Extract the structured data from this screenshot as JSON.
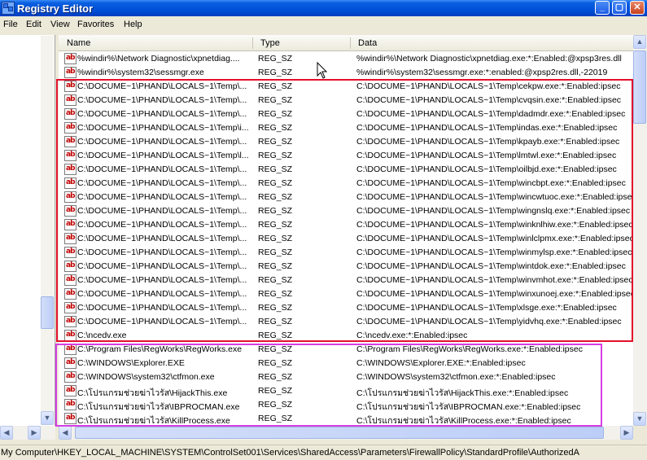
{
  "window": {
    "title": "Registry Editor",
    "min_glyph": "_",
    "max_glyph": "▢",
    "close_glyph": "✕"
  },
  "menu": [
    "File",
    "Edit",
    "View",
    "Favorites",
    "Help"
  ],
  "columns": {
    "name": "Name",
    "type": "Type",
    "data": "Data"
  },
  "icons": {
    "value": "reg-sz-value-icon",
    "value_glyph": "ab",
    "app": "registry-editor-icon",
    "cursor": "mouse-pointer-icon"
  },
  "rows": [
    {
      "name": "%windir%\\Network Diagnostic\\xpnetdiag....",
      "type": "REG_SZ",
      "data": "%windir%\\Network Diagnostic\\xpnetdiag.exe:*:Enabled:@xpsp3res.dll"
    },
    {
      "name": "%windir%\\system32\\sessmgr.exe",
      "type": "REG_SZ",
      "data": "%windir%\\system32\\sessmgr.exe:*:enabled:@xpsp2res.dll,-22019"
    },
    {
      "name": "C:\\DOCUME~1\\PHAND\\LOCALS~1\\Temp\\...",
      "type": "REG_SZ",
      "data": "C:\\DOCUME~1\\PHAND\\LOCALS~1\\Temp\\cekpw.exe:*:Enabled:ipsec"
    },
    {
      "name": "C:\\DOCUME~1\\PHAND\\LOCALS~1\\Temp\\...",
      "type": "REG_SZ",
      "data": "C:\\DOCUME~1\\PHAND\\LOCALS~1\\Temp\\cvqsin.exe:*:Enabled:ipsec"
    },
    {
      "name": "C:\\DOCUME~1\\PHAND\\LOCALS~1\\Temp\\...",
      "type": "REG_SZ",
      "data": "C:\\DOCUME~1\\PHAND\\LOCALS~1\\Temp\\dadmdr.exe:*:Enabled:ipsec"
    },
    {
      "name": "C:\\DOCUME~1\\PHAND\\LOCALS~1\\Temp\\i...",
      "type": "REG_SZ",
      "data": "C:\\DOCUME~1\\PHAND\\LOCALS~1\\Temp\\indas.exe:*:Enabled:ipsec"
    },
    {
      "name": "C:\\DOCUME~1\\PHAND\\LOCALS~1\\Temp\\...",
      "type": "REG_SZ",
      "data": "C:\\DOCUME~1\\PHAND\\LOCALS~1\\Temp\\kpayb.exe:*:Enabled:ipsec"
    },
    {
      "name": "C:\\DOCUME~1\\PHAND\\LOCALS~1\\Temp\\l...",
      "type": "REG_SZ",
      "data": "C:\\DOCUME~1\\PHAND\\LOCALS~1\\Temp\\lmtwl.exe:*:Enabled:ipsec"
    },
    {
      "name": "C:\\DOCUME~1\\PHAND\\LOCALS~1\\Temp\\...",
      "type": "REG_SZ",
      "data": "C:\\DOCUME~1\\PHAND\\LOCALS~1\\Temp\\oilbjd.exe:*:Enabled:ipsec"
    },
    {
      "name": "C:\\DOCUME~1\\PHAND\\LOCALS~1\\Temp\\...",
      "type": "REG_SZ",
      "data": "C:\\DOCUME~1\\PHAND\\LOCALS~1\\Temp\\wincbpt.exe:*:Enabled:ipsec"
    },
    {
      "name": "C:\\DOCUME~1\\PHAND\\LOCALS~1\\Temp\\...",
      "type": "REG_SZ",
      "data": "C:\\DOCUME~1\\PHAND\\LOCALS~1\\Temp\\wincwtuoc.exe:*:Enabled:ipsec"
    },
    {
      "name": "C:\\DOCUME~1\\PHAND\\LOCALS~1\\Temp\\...",
      "type": "REG_SZ",
      "data": "C:\\DOCUME~1\\PHAND\\LOCALS~1\\Temp\\wingnslq.exe:*:Enabled:ipsec"
    },
    {
      "name": "C:\\DOCUME~1\\PHAND\\LOCALS~1\\Temp\\...",
      "type": "REG_SZ",
      "data": "C:\\DOCUME~1\\PHAND\\LOCALS~1\\Temp\\winknlhiw.exe:*:Enabled:ipsec"
    },
    {
      "name": "C:\\DOCUME~1\\PHAND\\LOCALS~1\\Temp\\...",
      "type": "REG_SZ",
      "data": "C:\\DOCUME~1\\PHAND\\LOCALS~1\\Temp\\winlclpmx.exe:*:Enabled:ipsec"
    },
    {
      "name": "C:\\DOCUME~1\\PHAND\\LOCALS~1\\Temp\\...",
      "type": "REG_SZ",
      "data": "C:\\DOCUME~1\\PHAND\\LOCALS~1\\Temp\\winmylsp.exe:*:Enabled:ipsec"
    },
    {
      "name": "C:\\DOCUME~1\\PHAND\\LOCALS~1\\Temp\\...",
      "type": "REG_SZ",
      "data": "C:\\DOCUME~1\\PHAND\\LOCALS~1\\Temp\\wintdok.exe:*:Enabled:ipsec"
    },
    {
      "name": "C:\\DOCUME~1\\PHAND\\LOCALS~1\\Temp\\...",
      "type": "REG_SZ",
      "data": "C:\\DOCUME~1\\PHAND\\LOCALS~1\\Temp\\winvmhot.exe:*:Enabled:ipsec"
    },
    {
      "name": "C:\\DOCUME~1\\PHAND\\LOCALS~1\\Temp\\...",
      "type": "REG_SZ",
      "data": "C:\\DOCUME~1\\PHAND\\LOCALS~1\\Temp\\winxunoej.exe:*:Enabled:ipsec"
    },
    {
      "name": "C:\\DOCUME~1\\PHAND\\LOCALS~1\\Temp\\...",
      "type": "REG_SZ",
      "data": "C:\\DOCUME~1\\PHAND\\LOCALS~1\\Temp\\xlsge.exe:*:Enabled:ipsec"
    },
    {
      "name": "C:\\DOCUME~1\\PHAND\\LOCALS~1\\Temp\\...",
      "type": "REG_SZ",
      "data": "C:\\DOCUME~1\\PHAND\\LOCALS~1\\Temp\\yidvhq.exe:*:Enabled:ipsec"
    },
    {
      "name": "C:\\ncedv.exe",
      "type": "REG_SZ",
      "data": "C:\\ncedv.exe:*:Enabled:ipsec"
    },
    {
      "name": "C:\\Program Files\\RegWorks\\RegWorks.exe",
      "type": "REG_SZ",
      "data": "C:\\Program Files\\RegWorks\\RegWorks.exe:*:Enabled:ipsec"
    },
    {
      "name": "C:\\WINDOWS\\Explorer.EXE",
      "type": "REG_SZ",
      "data": "C:\\WINDOWS\\Explorer.EXE:*:Enabled:ipsec"
    },
    {
      "name": "C:\\WINDOWS\\system32\\ctfmon.exe",
      "type": "REG_SZ",
      "data": "C:\\WINDOWS\\system32\\ctfmon.exe:*:Enabled:ipsec"
    },
    {
      "name": "C:\\โปรแกรมช่วยฆ่าไวรัส\\HijackThis.exe",
      "type": "REG_SZ",
      "data": "C:\\โปรแกรมช่วยฆ่าไวรัส\\HijackThis.exe:*:Enabled:ipsec"
    },
    {
      "name": "C:\\โปรแกรมช่วยฆ่าไวรัส\\IBPROCMAN.exe",
      "type": "REG_SZ",
      "data": "C:\\โปรแกรมช่วยฆ่าไวรัส\\IBPROCMAN.exe:*:Enabled:ipsec"
    },
    {
      "name": "C:\\โปรแกรมช่วยฆ่าไวรัส\\KillProcess.exe",
      "type": "REG_SZ",
      "data": "C:\\โปรแกรมช่วยฆ่าไวรัส\\KillProcess.exe:*:Enabled:ipsec"
    }
  ],
  "highlights": {
    "red_color": "#e3102c",
    "magenta_color": "#d63ee3"
  },
  "scroll": {
    "up": "▲",
    "down": "▼",
    "left": "◀",
    "right": "▶"
  },
  "status": "My Computer\\HKEY_LOCAL_MACHINE\\SYSTEM\\ControlSet001\\Services\\SharedAccess\\Parameters\\FirewallPolicy\\StandardProfile\\AuthorizedA"
}
